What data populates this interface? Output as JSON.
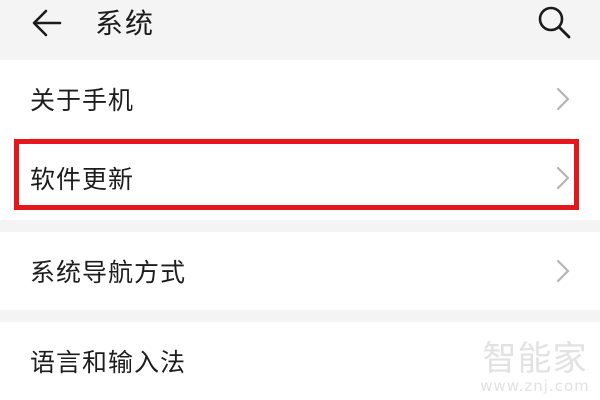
{
  "header": {
    "title": "系统",
    "back_icon": "arrow-left-icon",
    "search_icon": "search-icon"
  },
  "settings": {
    "items": [
      {
        "label": "关于手机",
        "icon": "chevron-right-icon"
      },
      {
        "label": "软件更新",
        "icon": "chevron-right-icon",
        "highlighted": true
      },
      {
        "label": "系统导航方式",
        "icon": "chevron-right-icon"
      },
      {
        "label": "语言和输入法",
        "icon": "chevron-right-icon"
      }
    ]
  },
  "watermark": {
    "text": "智能家",
    "url": "www.znj.com"
  },
  "colors": {
    "background": "#f4f4f4",
    "card": "#ffffff",
    "highlight_border": "#e5171d",
    "chevron": "#b5b5b5"
  }
}
